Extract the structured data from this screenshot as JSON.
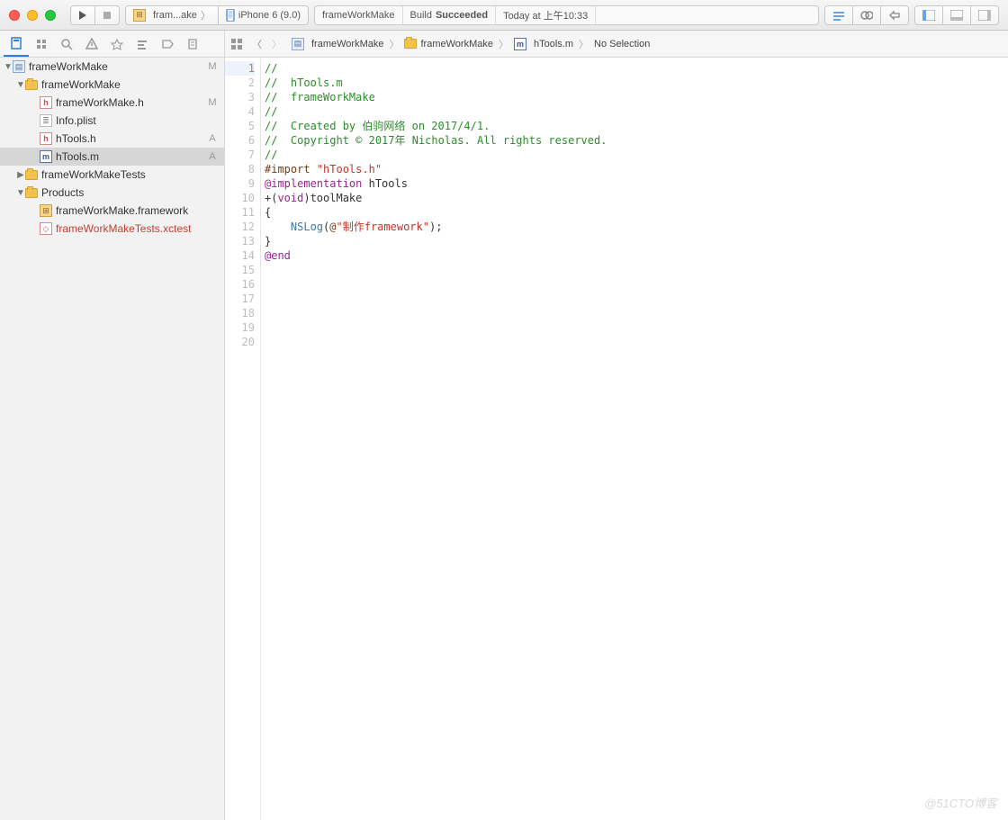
{
  "toolbar": {
    "scheme_label": "fram...ake",
    "device_label": "iPhone 6 (9.0)",
    "status_target": "frameWorkMake",
    "status_build_prefix": "Build ",
    "status_build_result": "Succeeded",
    "status_time": "Today at 上午10:33"
  },
  "breadcrumb": {
    "items": [
      {
        "icon": "proj",
        "label": "frameWorkMake"
      },
      {
        "icon": "folder",
        "label": "frameWorkMake"
      },
      {
        "icon": "m",
        "label": "hTools.m"
      },
      {
        "icon": "none",
        "label": "No Selection"
      }
    ]
  },
  "navigator": {
    "project": {
      "label": "frameWorkMake",
      "status": "M"
    },
    "group1": {
      "label": "frameWorkMake"
    },
    "file_h": {
      "label": "frameWorkMake.h",
      "status": "M"
    },
    "file_plist": {
      "label": "Info.plist"
    },
    "file_htools_h": {
      "label": "hTools.h",
      "status": "A"
    },
    "file_htools_m": {
      "label": "hTools.m",
      "status": "A"
    },
    "tests_folder": {
      "label": "frameWorkMakeTests"
    },
    "products_folder": {
      "label": "Products"
    },
    "product_fw": {
      "label": "frameWorkMake.framework"
    },
    "product_tests": {
      "label": "frameWorkMakeTests.xctest"
    }
  },
  "code": {
    "lines": [
      "",
      "//",
      "//  hTools.m",
      "//  frameWorkMake",
      "//",
      "//  Created by 伯驹网络 on 2017/4/1.",
      "//  Copyright © 2017年 Nicholas. All rights reserved.",
      "//",
      "",
      "#import \"hTools.h\"",
      "",
      "@implementation hTools",
      "",
      "+(void)toolMake",
      "{",
      "    NSLog(@\"制作framework\");",
      "}",
      "",
      "@end",
      ""
    ],
    "import_directive": "#import ",
    "import_string": "\"hTools.h\"",
    "impl_kw": "@implementation",
    "impl_name": " hTools",
    "method_sig_prefix": "+(",
    "method_sig_void": "void",
    "method_sig_suffix": ")toolMake",
    "brace_open": "{",
    "nslog_indent": "    ",
    "nslog_name": "NSLog",
    "nslog_open": "(",
    "nslog_at": "@",
    "nslog_string": "\"制作framework\"",
    "nslog_close": ");",
    "brace_close": "}",
    "end_kw": "@end"
  },
  "watermark": "@51CTO博客"
}
